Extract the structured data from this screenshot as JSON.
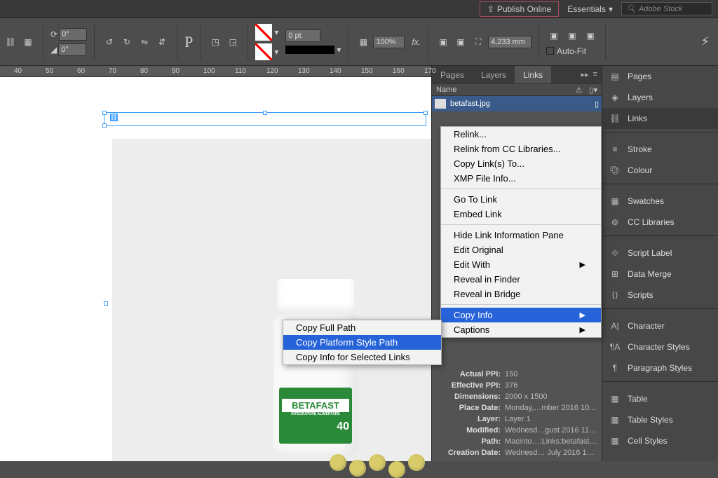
{
  "topbar": {
    "publish_online_label": "Publish Online",
    "workspace_label": "Essentials",
    "stock_placeholder": "Adobe Stock"
  },
  "controlbar": {
    "angle_rotate": "0°",
    "angle_shear": "0°",
    "stroke_weight": "0 pt",
    "stroke_opacity": "100%",
    "dimension": "4,233 mm",
    "autofit_label": "Auto-Fit"
  },
  "ruler": {
    "ticks": [
      "40",
      "50",
      "60",
      "70",
      "80",
      "90",
      "100",
      "110",
      "120",
      "130",
      "140",
      "150",
      "160",
      "170"
    ]
  },
  "links_panel": {
    "tabs": [
      "Pages",
      "Layers",
      "Links"
    ],
    "active_tab": "Links",
    "header": "Name",
    "item_filename": "betafast.jpg"
  },
  "link_info": {
    "actual_ppi_lbl": "Actual PPI:",
    "actual_ppi": "150",
    "effective_ppi_lbl": "Effective PPI:",
    "effective_ppi": "376",
    "dimensions_lbl": "Dimensions:",
    "dimensions": "2000 x 1500",
    "place_date_lbl": "Place Date:",
    "place_date": "Monday,…mber 2016 10:59",
    "layer_lbl": "Layer:",
    "layer": "Layer 1",
    "modified_lbl": "Modified:",
    "modified": "Wednesd…gust 2016 11:08",
    "path_lbl": "Path:",
    "path": "Macinto…:Links:betafast.jpg",
    "creation_lbl": "Creation Date:",
    "creation": "Wednesd… July 2016 10:59"
  },
  "right_panel": {
    "items": [
      "Pages",
      "Layers",
      "Links",
      "Stroke",
      "Colour",
      "Swatches",
      "CC Libraries",
      "Script Label",
      "Data Merge",
      "Scripts",
      "Character",
      "Character Styles",
      "Paragraph Styles",
      "Table",
      "Table Styles",
      "Cell Styles"
    ],
    "active_index": 2
  },
  "context_main": {
    "items": [
      {
        "label": "Relink...",
        "type": "item"
      },
      {
        "label": "Relink from CC Libraries...",
        "type": "item"
      },
      {
        "label": "Copy Link(s) To...",
        "type": "item"
      },
      {
        "label": "XMP File Info...",
        "type": "item"
      },
      {
        "type": "sep"
      },
      {
        "label": "Go To Link",
        "type": "item"
      },
      {
        "label": "Embed Link",
        "type": "item"
      },
      {
        "type": "sep"
      },
      {
        "label": "Hide Link Information Pane",
        "type": "item"
      },
      {
        "label": "Edit Original",
        "type": "item"
      },
      {
        "label": "Edit With",
        "type": "submenu"
      },
      {
        "label": "Reveal in Finder",
        "type": "item"
      },
      {
        "label": "Reveal in Bridge",
        "type": "item"
      },
      {
        "type": "sep"
      },
      {
        "label": "Copy Info",
        "type": "submenu",
        "highlighted": true
      },
      {
        "label": "Captions",
        "type": "submenu"
      }
    ]
  },
  "context_sub": {
    "items": [
      {
        "label": "Copy Full Path"
      },
      {
        "label": "Copy Platform Style Path",
        "highlighted": true
      },
      {
        "label": "Copy Info for Selected Links"
      }
    ]
  },
  "bottle": {
    "brand": "BETAFAST",
    "sub": "INTEGRATORE ALIMENTARE",
    "count": "40"
  }
}
